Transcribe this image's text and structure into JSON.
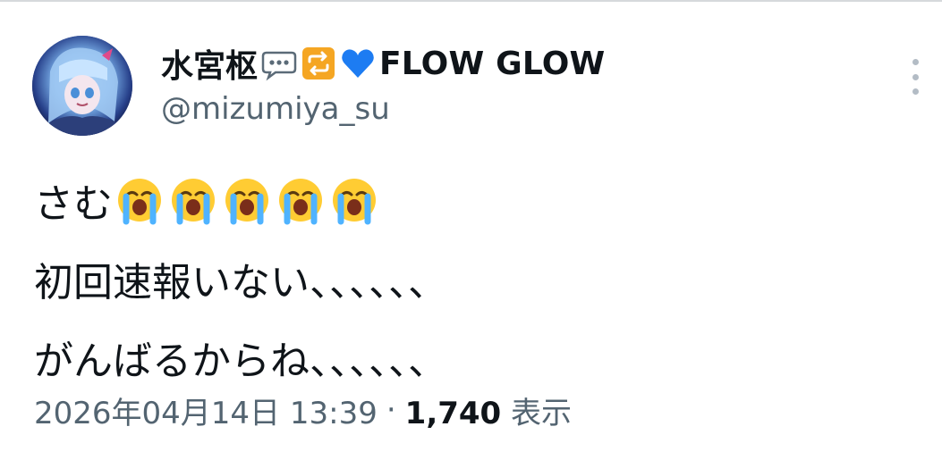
{
  "post": {
    "display_name": "水宮枢",
    "brand": "FLOW GLOW",
    "handle": "@mizumiya_su",
    "lines": [
      "さむ",
      "初回速報いない、、、、、、",
      "がんばるからね、、、、、、"
    ],
    "timestamp": "2026年04月14日 13:39",
    "separator": "·",
    "views_count": "1,740",
    "views_label": "表示"
  },
  "icons": {
    "badges": [
      "speech-bubble-icon",
      "repeat-icon",
      "blue-heart-icon"
    ],
    "line1_emojis": [
      "loudly-crying-face-icon",
      "loudly-crying-face-icon",
      "loudly-crying-face-icon",
      "loudly-crying-face-icon",
      "loudly-crying-face-icon"
    ],
    "more": "more-options-icon"
  },
  "colors": {
    "text_primary": "#0f1419",
    "text_secondary": "#536471",
    "badge_orange": "#f5a623",
    "heart_blue": "#1d7cf2"
  }
}
